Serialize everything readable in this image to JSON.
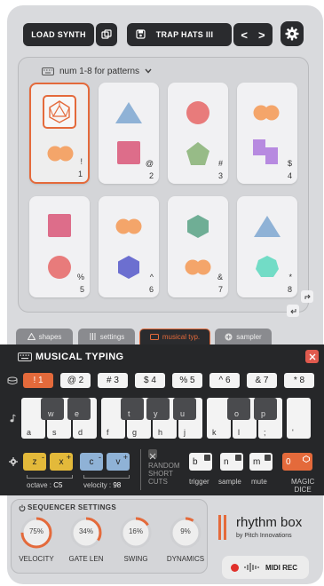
{
  "header": {
    "load_synth": "LOAD SYNTH",
    "preset_name": "TRAP HATS III",
    "prev": "<",
    "next": ">"
  },
  "pads": {
    "mode_label": "num 1-8 for patterns",
    "items": [
      {
        "key": "!",
        "num": "1"
      },
      {
        "key": "@",
        "num": "2"
      },
      {
        "key": "#",
        "num": "3"
      },
      {
        "key": "$",
        "num": "4"
      },
      {
        "key": "%",
        "num": "5"
      },
      {
        "key": "^",
        "num": "6"
      },
      {
        "key": "&",
        "num": "7"
      },
      {
        "key": "*",
        "num": "8"
      }
    ]
  },
  "tabs": [
    "shapes",
    "settings",
    "musical typ.",
    "sampler"
  ],
  "musical_typing": {
    "title": "MUSICAL TYPING",
    "patterns": [
      "! 1",
      "@ 2",
      "# 3",
      "$ 4",
      "% 5",
      "^ 6",
      "& 7",
      "* 8"
    ],
    "white_keys": [
      "a",
      "s",
      "d",
      "f",
      "g",
      "h",
      "j",
      "k",
      "l",
      ";",
      "'"
    ],
    "black_keys": [
      "w",
      "e",
      "t",
      "y",
      "u",
      "o",
      "p"
    ],
    "octave_down": "z",
    "octave_up": "x",
    "velocity_down": "c",
    "velocity_up": "v",
    "octave_label": "octave :",
    "octave_value": "C5",
    "velocity_label": "velocity :",
    "velocity_value": "98",
    "random_label_1": "RANDOM",
    "random_label_2": "SHORT",
    "random_label_3": "CUTS",
    "trigger_key": "b",
    "trigger_label": "trigger",
    "sample_key": "n",
    "sample_label": "sample",
    "mute_key": "m",
    "mute_label": "mute",
    "dice_key": "0",
    "dice_label_1": "MAGIC",
    "dice_label_2": "DICE",
    "minus": "-",
    "plus": "+"
  },
  "sequencer": {
    "title": "SEQUENCER SETTINGS",
    "knobs": [
      {
        "label": "VELOCITY",
        "value": "75%",
        "level": 0.75
      },
      {
        "label": "GATE LEN",
        "value": "34%",
        "level": 0.34
      },
      {
        "label": "SWING",
        "value": "16%",
        "level": 0.16
      },
      {
        "label": "DYNAMICS",
        "value": "9%",
        "level": 0.09
      }
    ]
  },
  "brand": {
    "name": "rhythm box",
    "by": "by Pitch Innovations"
  },
  "midi_rec": "MIDI REC",
  "colors": {
    "accent": "#e46a3b",
    "red": "#e05a4e",
    "yellow": "#e3b93a",
    "blue": "#8fb2d6",
    "dark": "#262729"
  }
}
